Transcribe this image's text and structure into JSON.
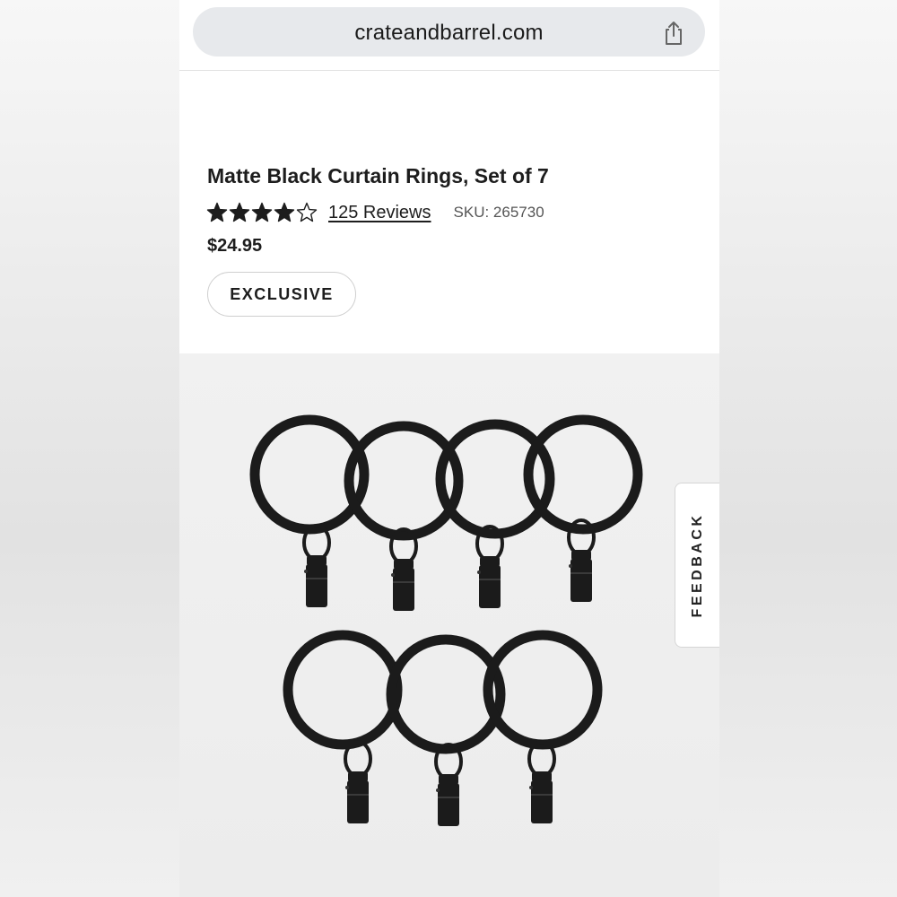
{
  "browser": {
    "url": "crateandbarrel.com",
    "share_icon": "share-icon"
  },
  "product": {
    "title": "Matte Black Curtain Rings, Set of 7",
    "rating": 4,
    "rating_max": 5,
    "reviews_label": "125 Reviews",
    "sku_label": "SKU: 265730",
    "price": "$24.95",
    "badge": "EXCLUSIVE"
  },
  "feedback": {
    "label": "FEEDBACK"
  },
  "colors": {
    "ring": "#1b1b1b",
    "text": "#1d1d1d"
  }
}
